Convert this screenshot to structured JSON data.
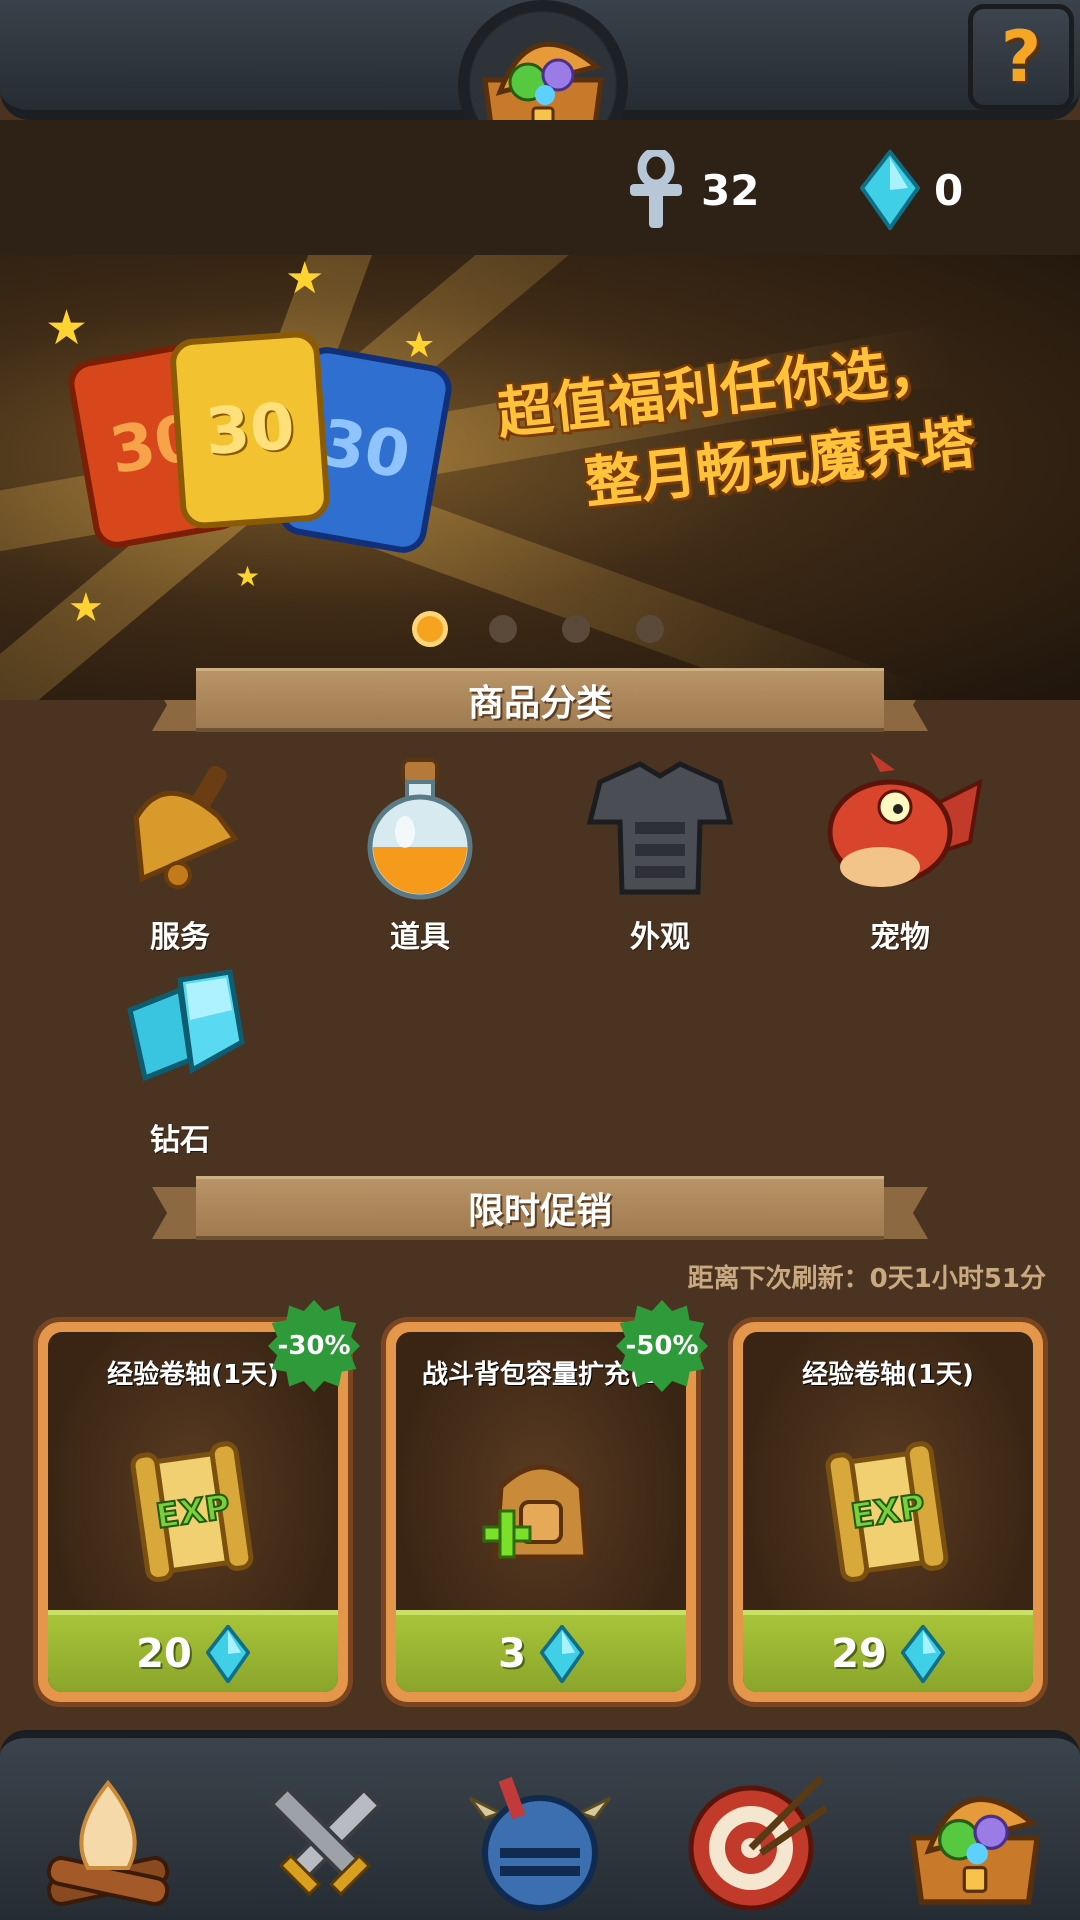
{
  "header": {
    "help_label": "?",
    "chest_icon": "treasure-chest-icon"
  },
  "currency": {
    "ankh": {
      "icon": "ankh-icon",
      "value": "32"
    },
    "diamond": {
      "icon": "diamond-icon",
      "value": "0"
    }
  },
  "banner": {
    "line1": "超值福利任你选，",
    "line2": "整月畅玩魔界塔",
    "cards": [
      "30",
      "30",
      "30"
    ],
    "page_count": 4,
    "active_page": 1
  },
  "categories": {
    "title": "商品分类",
    "items": [
      {
        "label": "服务",
        "icon": "bell-icon"
      },
      {
        "label": "道具",
        "icon": "potion-icon"
      },
      {
        "label": "外观",
        "icon": "armor-icon"
      },
      {
        "label": "宠物",
        "icon": "dragon-icon"
      },
      {
        "label": "钻石",
        "icon": "diamond-icon"
      }
    ]
  },
  "sale": {
    "title": "限时促销",
    "refresh_label": "距离下次刷新：",
    "refresh_value": "0天1小时51分",
    "products": [
      {
        "title": "经验卷轴(1天)",
        "price": "20",
        "discount": "-30%",
        "icon": "exp-scroll-icon"
      },
      {
        "title": "战斗背包容量扩充(1",
        "price": "3",
        "discount": "-50%",
        "icon": "backpack-plus-icon"
      },
      {
        "title": "经验卷轴(1天)",
        "price": "29",
        "discount": "",
        "icon": "exp-scroll-icon"
      }
    ]
  },
  "bottom_nav": [
    {
      "icon": "campfire-icon"
    },
    {
      "icon": "crossed-swords-icon"
    },
    {
      "icon": "knight-helmet-icon"
    },
    {
      "icon": "target-arrows-icon"
    },
    {
      "icon": "treasure-chest-icon"
    }
  ],
  "colors": {
    "background": "#4a3320",
    "banner_text": "#ffc23a",
    "price_bar": "#a8c43a",
    "badge": "#2e9a3a",
    "card_frame": "#e4974a"
  }
}
